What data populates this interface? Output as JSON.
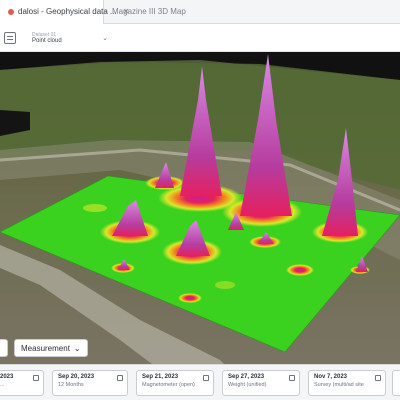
{
  "tabs": [
    {
      "label": "dalosi - Geophysical data ...",
      "active": true
    },
    {
      "label": "Magazine III 3D Map",
      "active": false
    }
  ],
  "toolbar": {
    "dataset_caption": "Dataset 01",
    "dataset_value": "Point cloud"
  },
  "scene": {
    "heatmap_colors": [
      "#3bd11f",
      "#d8e82a",
      "#f28b1e",
      "#e5205f",
      "#c9208f",
      "#c77ad6"
    ]
  },
  "measurement_button": {
    "label": "Measurement",
    "icon": "chevron-down-icon"
  },
  "timeline": [
    {
      "date": "2023",
      "name": "..."
    },
    {
      "date": "Sep 20, 2023",
      "name": "12 Months"
    },
    {
      "date": "Sep 21, 2023",
      "name": "Magnetometer (open)"
    },
    {
      "date": "Sep 27, 2023",
      "name": "Weight (unified)"
    },
    {
      "date": "Nov 7, 2023",
      "name": "Survey (multi/ad site"
    },
    {
      "date": "",
      "name": ""
    }
  ]
}
